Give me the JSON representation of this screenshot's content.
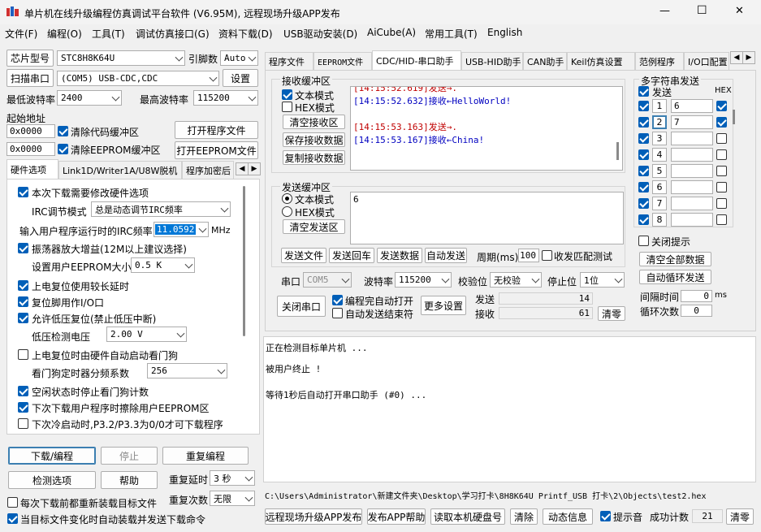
{
  "window": {
    "title": "单片机在线升级编程仿真调试平台软件 (V6.95M), 远程现场升级APP发布",
    "minimize": "—",
    "maximize": "☐",
    "close": "✕"
  },
  "menu": [
    "文件(F)",
    "编程(O)",
    "工具(T)",
    "调试仿真接口(G)",
    "资料下载(D)",
    "USB驱动安装(D)",
    "AiCube(A)",
    "常用工具(T)",
    "English"
  ],
  "left": {
    "chip_label": "芯片型号",
    "chip_value": "STC8H8K64U",
    "pin_label": "引脚数",
    "pin_value": "Auto",
    "scan_port": "扫描串口",
    "port_value": "(COM5) USB-CDC,CDC",
    "settings": "设置",
    "min_baud_label": "最低波特率",
    "min_baud_value": "2400",
    "max_baud_label": "最高波特率",
    "max_baud_value": "115200",
    "start_addr_label": "起始地址",
    "addr1": "0x0000",
    "clear_code": "清除代码缓冲区",
    "open_prog": "打开程序文件",
    "addr2": "0x0000",
    "clear_eeprom": "清除EEPROM缓冲区",
    "open_eeprom": "打开EEPROM文件",
    "tabs": [
      "硬件选项",
      "Link1D/Writer1A/U8W脱机",
      "程序加密后"
    ],
    "options": {
      "opt1": "本次下载需要修改硬件选项",
      "irc_mode_label": "IRC调节模式",
      "irc_mode_value": "总是动态调节IRC频率",
      "irc_freq_label": "输入用户程序运行时的IRC频率",
      "irc_freq_value": "11.0592",
      "irc_unit": "MHz",
      "opt2": "振荡器放大增益(12M以上建议选择)",
      "eeprom_size_label": "设置用户EEPROM大小",
      "eeprom_size_value": "0.5 K",
      "opt3": "上电复位使用较长延时",
      "opt4": "复位脚用作I/O口",
      "opt5": "允许低压复位(禁止低压中断)",
      "lvd_label": "低压检测电压",
      "lvd_value": "2.00 V",
      "opt6": "上电复位时由硬件自动启动看门狗",
      "wdt_label": "看门狗定时器分频系数",
      "wdt_value": "256",
      "opt7": "空闲状态时停止看门狗计数",
      "opt8": "下次下载用户程序时擦除用户EEPROM区",
      "opt9": "下次冷启动时,P3.2/P3.3为0/0才可下载程序"
    },
    "download": "下载/编程",
    "stop": "停止",
    "reprogram": "重复编程",
    "check_options": "检测选项",
    "help": "帮助",
    "repeat_delay_label": "重复延时",
    "repeat_delay_value": "3 秒",
    "repeat_count_label": "重复次数",
    "repeat_count_value": "无限",
    "reload_each": "每次下载前都重新装载目标文件",
    "auto_reload": "当目标文件变化时自动装载并发送下载命令"
  },
  "right_tabs": [
    "程序文件",
    "EEPROM文件",
    "CDC/HID-串口助手",
    "USB-HID助手",
    "CAN助手",
    "Keil仿真设置",
    "范例程序",
    "I/O口配置"
  ],
  "serial": {
    "recv_title": "接收缓冲区",
    "text_mode": "文本模式",
    "hex_mode": "HEX模式",
    "clear_recv": "清空接收区",
    "save_recv": "保存接收数据",
    "copy_recv": "复制接收数据",
    "recv_lines": [
      {
        "time": "[14:15:52.619]",
        "dir": "发送→",
        "text": ".",
        "color": "#c00000"
      },
      {
        "time": "[14:15:52.632]",
        "dir": "接收←",
        "text": "HelloWorld!",
        "color": "#0000c0"
      },
      {
        "time": "",
        "dir": "",
        "text": "",
        "color": "#000"
      },
      {
        "time": "[14:15:53.163]",
        "dir": "发送→",
        "text": ".",
        "color": "#c00000"
      },
      {
        "time": "[14:15:53.167]",
        "dir": "接收←",
        "text": "China!",
        "color": "#0000c0"
      }
    ],
    "send_title": "发送缓冲区",
    "send_text_mode": "文本模式",
    "send_hex_mode": "HEX模式",
    "clear_send": "清空发送区",
    "send_content": "6",
    "send_file": "发送文件",
    "send_return": "发送回车",
    "send_data": "发送数据",
    "auto_send": "自动发送",
    "period_label": "周期(ms)",
    "period_value": "100",
    "match_label": "收发匹配测试",
    "port_label": "串口",
    "port_value": "COM5",
    "baud_label": "波特率",
    "baud_value": "115200",
    "parity_label": "校验位",
    "parity_value": "无校验",
    "stop_label": "停止位",
    "stop_value": "1位",
    "close_port": "关闭串口",
    "open_after_prog": "编程完自动打开",
    "auto_send_end": "自动发送结束符",
    "more_settings": "更多设置",
    "send_count_label": "发送",
    "send_count": "14",
    "recv_count_label": "接收",
    "recv_count": "61",
    "clear_count": "清零"
  },
  "multi": {
    "title": "多字符串发送",
    "send_col": "发送",
    "hex_col": "HEX",
    "rows": [
      {
        "n": "1",
        "val": "6",
        "send": true,
        "hex": true
      },
      {
        "n": "2",
        "val": "7",
        "send": true,
        "hex": true
      },
      {
        "n": "3",
        "val": "",
        "send": true,
        "hex": false
      },
      {
        "n": "4",
        "val": "",
        "send": true,
        "hex": false
      },
      {
        "n": "5",
        "val": "",
        "send": true,
        "hex": false
      },
      {
        "n": "6",
        "val": "",
        "send": true,
        "hex": false
      },
      {
        "n": "7",
        "val": "",
        "send": true,
        "hex": false
      },
      {
        "n": "8",
        "val": "",
        "send": true,
        "hex": false
      }
    ],
    "close_hint": "关闭提示",
    "clear_all": "清空全部数据",
    "auto_loop": "自动循环发送",
    "interval_label": "间隔时间",
    "interval_value": "0",
    "interval_unit": "ms",
    "loop_label": "循环次数",
    "loop_value": "0"
  },
  "log": [
    "正在检测目标单片机 ...",
    "被用户终止 !",
    "等待1秒后自动打开串口助手 (#0) ..."
  ],
  "path": "C:\\Users\\Administrator\\新建文件夹\\Desktop\\学习打卡\\8H8K64U Printf_USB 打卡\\2\\Objects\\test2.hex",
  "bottom": {
    "publish": "远程现场升级APP发布",
    "publish_help": "发布APP帮助",
    "read_disk": "读取本机硬盘号",
    "clear": "清除",
    "anim": "动态信息",
    "sound": "提示音",
    "success_label": "成功计数",
    "success_value": "21",
    "clear_count": "清零"
  }
}
